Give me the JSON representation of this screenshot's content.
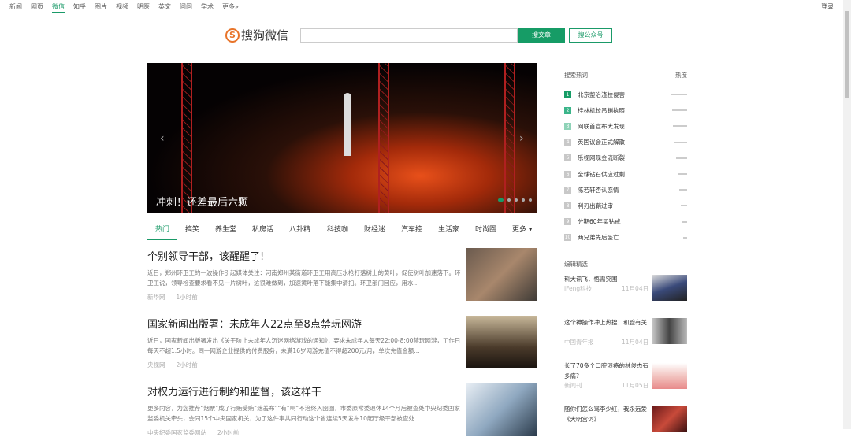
{
  "topnav": {
    "items": [
      "新闻",
      "网页",
      "微信",
      "知乎",
      "图片",
      "视频",
      "明医",
      "英文",
      "问问",
      "学术",
      "更多»"
    ],
    "login": "登录"
  },
  "logo": {
    "mark": "S",
    "text": "搜狗微信"
  },
  "search": {
    "value": "",
    "btn_article": "搜文章",
    "btn_account": "搜公众号"
  },
  "carousel": {
    "caption": "冲刺！还差最后六颗",
    "prev": "‹",
    "next": "›"
  },
  "tabs": [
    "热门",
    "搞笑",
    "养生堂",
    "私房话",
    "八卦精",
    "科技咖",
    "财经迷",
    "汽车控",
    "生活家",
    "时尚圈",
    "更多 ▾"
  ],
  "articles": [
    {
      "title": "个别领导干部，该醒醒了!",
      "summary": "近日，郑州环卫工的一波操作引起媒体关注：河南郑州某街道环卫工用高压水枪打落树上的黄叶，促使树叶加速落下。环卫工说，领导检查要求看不见一片树叶，这很难做到，加速黄叶落下能集中清扫。环卫部门回应，用水...",
      "source": "新华网",
      "time": "1小时前"
    },
    {
      "title": "国家新闻出版署：未成年人22点至8点禁玩网游",
      "summary": "近日，国家新闻出版署发出《关于防止未成年人沉迷网络游戏的通知》，要求未成年人每天22:00-8:00禁玩网游，工作日每天不超1.5小时。同一网游企业提供的付费服务，未满16岁网游充值不得超200元/月，单次充值金额...",
      "source": "央视网",
      "time": "2小时前"
    },
    {
      "title": "对权力运行进行制约和监督，该这样干",
      "summary": "更多内容，为您推荐“烟票”成了行贿受贿“遮羞布”“有”啊“不治终入囹圄，市委原常委退休14个月后被查处中央纪委国家监委机关牵头，会同15个中央国家机关，为了这件事共同行动这个省连续5天发布10起厅级干部被查处...",
      "source": "中央纪委国家监委网站",
      "time": "2小时前"
    }
  ],
  "hot": {
    "title": "搜索热词",
    "heat": "热度",
    "items": [
      "北京整治渣校侵害",
      "桂林机长吊销执照",
      "网联首宣布大发现",
      "英国议会正式解散",
      "乐视网现金流断裂",
      "全球钻石供应过剩",
      "陈若轩否认恋情",
      "利刃出鞘过审",
      "分期60年买钻戒",
      "两兄弟先后坠亡"
    ],
    "heat_levels": [
      1,
      0.95,
      0.9,
      0.85,
      0.7,
      0.6,
      0.5,
      0.4,
      0.3,
      0.25
    ]
  },
  "editor": {
    "title": "编辑精选",
    "items": [
      {
        "title": "科大讯飞，悟需突围",
        "source": "iFeng科技",
        "date": "11月04日"
      },
      {
        "title": "这个神操作冲上热搜！和脸有关",
        "source": "中国青年报",
        "date": "11月04日"
      },
      {
        "title": "长了70多个口腔溃疡的林俊杰有多痛?",
        "source": "新闻刊",
        "date": "11月05日"
      },
      {
        "title": "随你们怎么骂李少红，我永远爱《大明宫词》"
      }
    ]
  }
}
